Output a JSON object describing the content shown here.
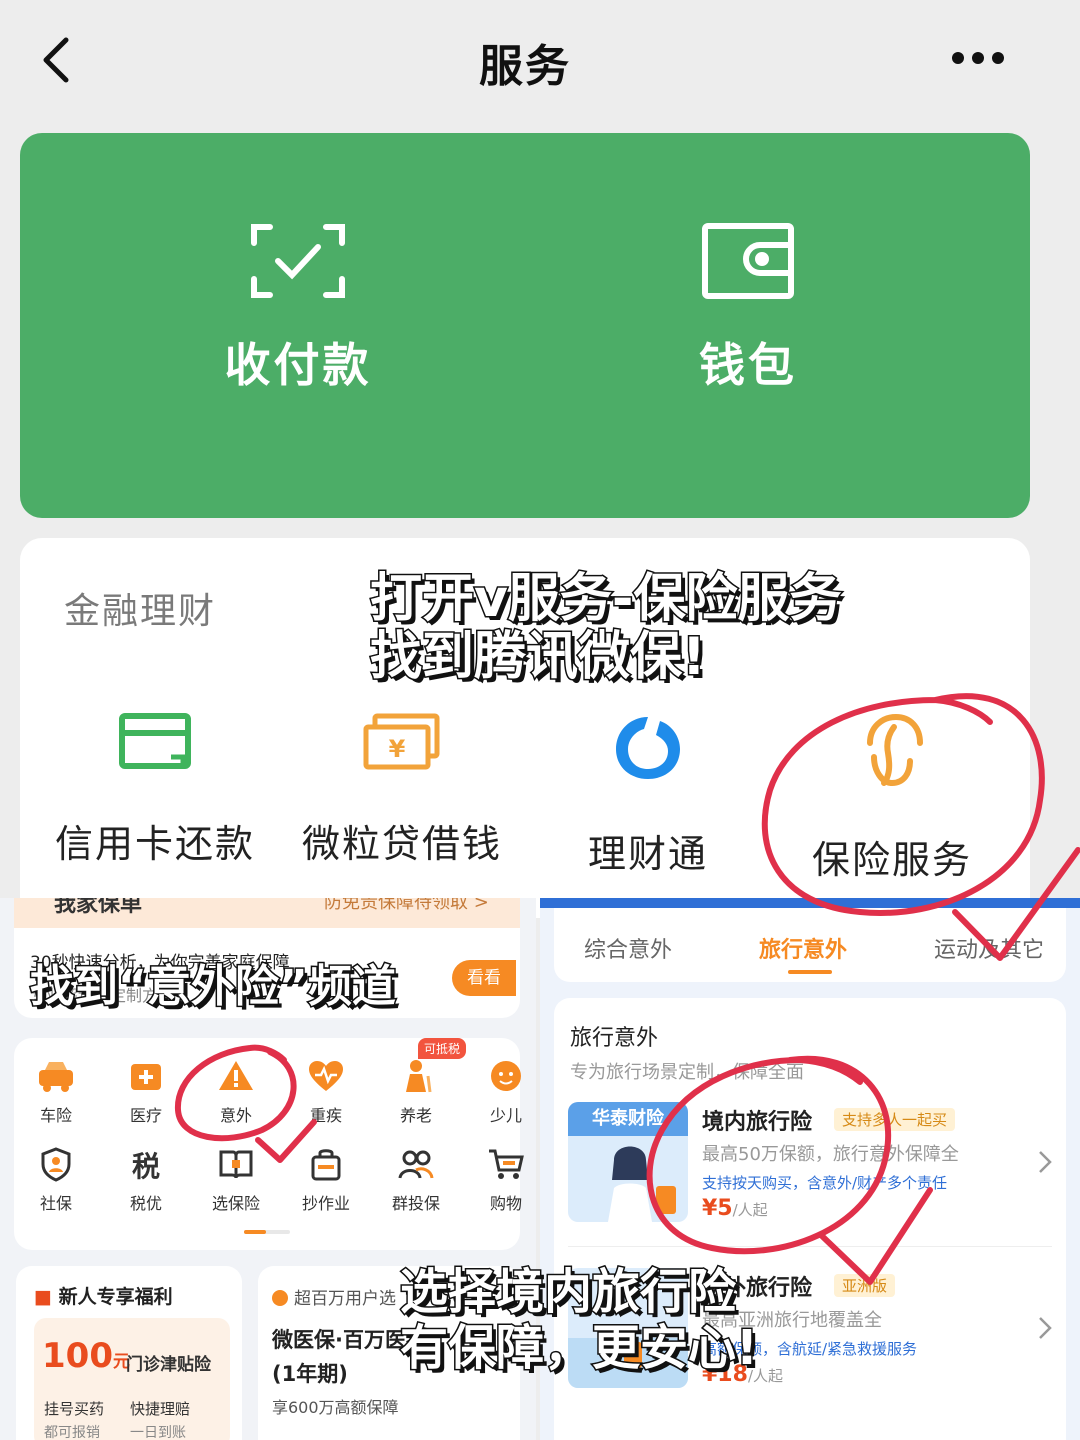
{
  "header": {
    "title": "服务"
  },
  "green_card": {
    "items": [
      {
        "label": "收付款",
        "icon": "scan-pay-icon"
      },
      {
        "label": "钱包",
        "icon": "wallet-icon"
      }
    ]
  },
  "finance": {
    "title": "金融理财",
    "items": [
      {
        "label": "信用卡还款",
        "icon": "credit-card-icon"
      },
      {
        "label": "微粒贷借钱",
        "icon": "cash-icon"
      },
      {
        "label": "理财通",
        "icon": "licaitong-icon"
      },
      {
        "label": "保险服务",
        "icon": "insurance-umbrella-icon"
      }
    ]
  },
  "insurance_app": {
    "banner": {
      "top_left": "我家保单",
      "top_right": "防免责保障待领取 >",
      "line1": "30秒快速分析，为你完善家庭保障",
      "line2": "专业解读，定制方案",
      "button": "看看"
    },
    "tax_badge": "可抵税",
    "grid": [
      {
        "label": "车险",
        "icon": "car-icon"
      },
      {
        "label": "医疗",
        "icon": "medical-kit-icon"
      },
      {
        "label": "意外",
        "icon": "warning-icon"
      },
      {
        "label": "重疾",
        "icon": "heart-pulse-icon"
      },
      {
        "label": "养老",
        "icon": "elderly-icon"
      },
      {
        "label": "少儿",
        "icon": "child-icon"
      },
      {
        "label": "社保",
        "icon": "shield-person-icon"
      },
      {
        "label": "税优",
        "icon": "tax-icon"
      },
      {
        "label": "选保险",
        "icon": "book-icon"
      },
      {
        "label": "抄作业",
        "icon": "bag-icon"
      },
      {
        "label": "群投保",
        "icon": "group-icon"
      },
      {
        "label": "购物",
        "icon": "cart-icon"
      }
    ],
    "newbie": {
      "title": "新人专享福利",
      "amount": "100",
      "unit": "元",
      "desc": "门诊津贴险",
      "c1": "挂号买药",
      "c2": "快捷理赔",
      "c3": "都可报销",
      "c4": "一日到账"
    },
    "product": {
      "tag": "超百万用户选",
      "name": "微医保·百万医疗",
      "term": "(1年期)",
      "desc": "享600万高额保障"
    }
  },
  "travel": {
    "tabs": [
      "综合意外",
      "旅行意外",
      "运动及其它"
    ],
    "active_tab": "旅行意外",
    "section_title": "旅行意外",
    "section_sub": "专为旅行场景定制，保障全面",
    "products": [
      {
        "brand": "华泰财险",
        "name": "境内旅行险",
        "tag": "支持多人一起买",
        "line1": "最高50万保额，旅行意外保障全",
        "line2": "支持按天购买，含意外/财产多个责任",
        "price": "¥5",
        "unit": "/人起"
      },
      {
        "brand": "",
        "name": "境外旅行险",
        "tag": "亚洲版",
        "line1": "最高亚洲旅行地覆盖全",
        "line2": "高额保额，含航延/紧急救援服务",
        "price": "¥18",
        "unit": "/人起"
      }
    ]
  },
  "captions": {
    "c1_l1": "打开v服务-保险服务",
    "c1_l2": "找到腾讯微保!",
    "c2": "找到“意外险”频道",
    "c3_l1": "选择境内旅行险",
    "c3_l2": "有保障，更安心!"
  },
  "colors": {
    "wechat_green": "#4cad67",
    "accent_orange": "#f68a23",
    "annotation_red": "#e0304a"
  }
}
